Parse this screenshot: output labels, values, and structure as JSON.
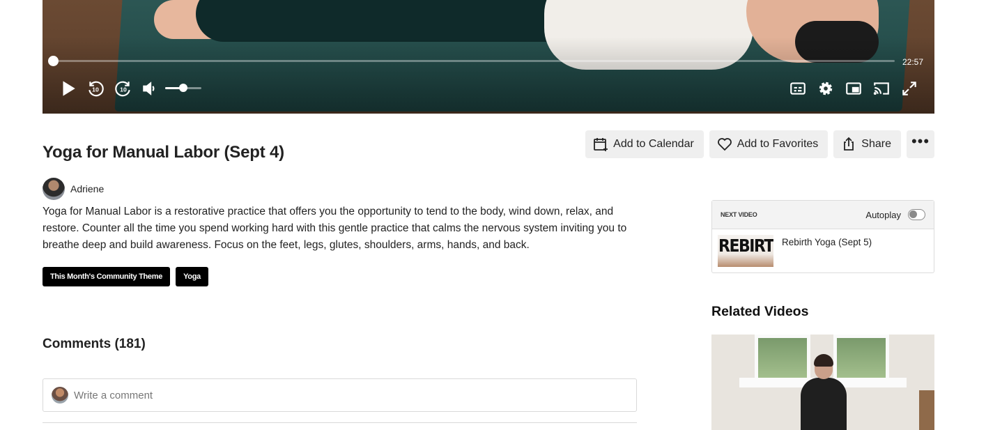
{
  "player": {
    "duration": "22:57",
    "progress_fraction": 0.0,
    "volume_fraction": 0.5,
    "controls_left": [
      "play-icon",
      "rewind-10-icon",
      "forward-10-icon",
      "volume-icon"
    ],
    "controls_right": [
      "captions-icon",
      "settings-icon",
      "picture-in-picture-icon",
      "cast-icon",
      "fullscreen-icon"
    ],
    "replay_seconds": "10"
  },
  "video": {
    "title": "Yoga for Manual Labor (Sept 4)",
    "author": "Adriene",
    "description": "Yoga for Manual Labor is a restorative practice that offers you the opportunity to tend to the body, wind down, relax, and restore. Counter all the time you spend working hard with this gentle practice that calms the nervous system inviting you to breathe deep and build awareness. Focus on the feet, legs, glutes, shoulders, arms, hands, and back.",
    "tags": [
      "This Month's Community Theme",
      "Yoga"
    ]
  },
  "actions": {
    "calendar": "Add to Calendar",
    "favorites": "Add to Favorites",
    "share": "Share",
    "more": "•••"
  },
  "comments": {
    "heading": "Comments (181)",
    "placeholder": "Write a comment"
  },
  "next_video": {
    "label": "NEXT VIDEO",
    "autoplay_label": "Autoplay",
    "autoplay_on": false,
    "thumb_text": "REBIRTH",
    "title": "Rebirth Yoga (Sept 5)"
  },
  "related": {
    "heading": "Related Videos"
  }
}
